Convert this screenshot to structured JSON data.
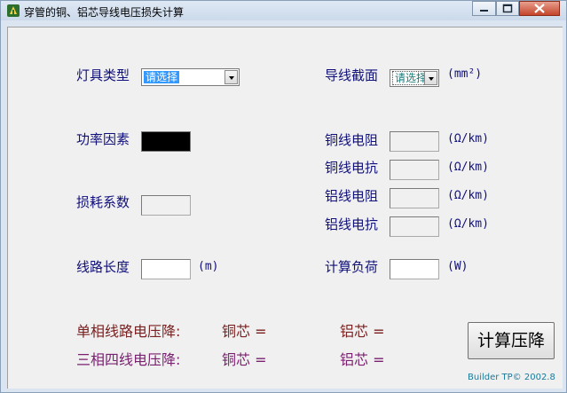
{
  "window": {
    "title": "穿管的铜、铝芯导线电压损失计算"
  },
  "form": {
    "lamp_type": {
      "label": "灯具类型",
      "selected": "请选择"
    },
    "wire_section": {
      "label": "导线截面",
      "selected": "请选择",
      "unit": "(mm²)"
    },
    "power_factor": {
      "label": "功率因素"
    },
    "loss_coefficient": {
      "label": "损耗系数"
    },
    "line_length": {
      "label": "线路长度",
      "unit": "(m)"
    },
    "copper_resistance": {
      "label": "铜线电阻",
      "unit": "(Ω/km)"
    },
    "copper_reactance": {
      "label": "铜线电抗",
      "unit": "(Ω/km)"
    },
    "aluminum_resistance": {
      "label": "铝线电阻",
      "unit": "(Ω/km)"
    },
    "aluminum_reactance": {
      "label": "铝线电抗",
      "unit": "(Ω/km)"
    },
    "calc_load": {
      "label": "计算负荷",
      "unit": "(W)"
    }
  },
  "results": {
    "single_phase_label": "单相线路电压降:",
    "three_phase_label": "三相四线电压降:",
    "copper": "铜芯  =",
    "aluminum": "铝芯  ="
  },
  "colors": {
    "single_phase": "#7a2020",
    "three_phase": "#7a2070"
  },
  "calculate_button": "计算压降",
  "footer": "Builder TP© 2002.8"
}
